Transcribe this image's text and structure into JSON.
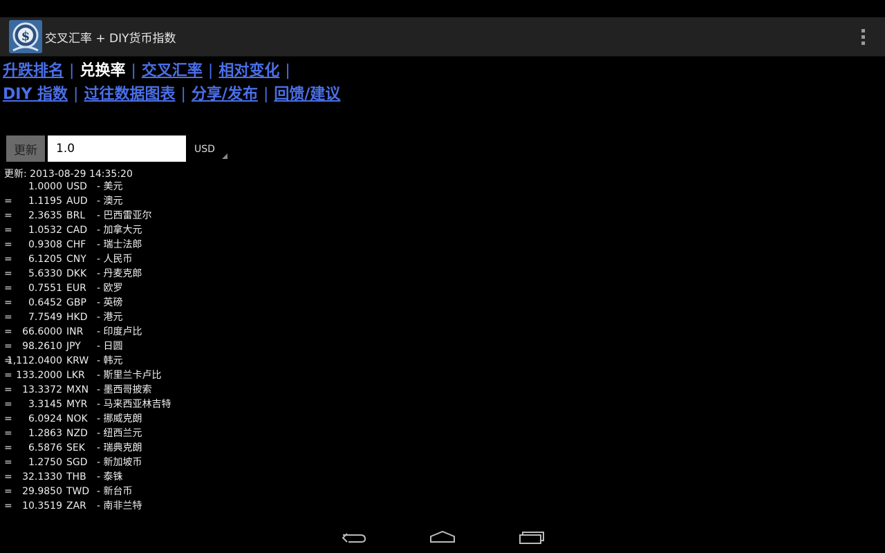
{
  "app": {
    "title": "交叉汇率 + DIY货币指数",
    "icon_name": "dollar-logo-icon",
    "menu_icon": "overflow-menu-icon"
  },
  "nav": {
    "row1": [
      {
        "label": "升跌排名",
        "current": false
      },
      {
        "label": "兑换率",
        "current": true
      },
      {
        "label": "交叉汇率",
        "current": false
      },
      {
        "label": "相对变化",
        "current": false
      }
    ],
    "row2": [
      {
        "label": "DIY 指数",
        "current": false
      },
      {
        "label": "过往数据图表",
        "current": false
      },
      {
        "label": "分享/发布",
        "current": false
      },
      {
        "label": "回馈/建议",
        "current": false
      }
    ],
    "separator": "|"
  },
  "converter": {
    "refresh_label": "更新",
    "amount_value": "1.0",
    "currency": "USD"
  },
  "updated": "更新: 2013-08-29 14:35:20",
  "rates": [
    {
      "eq": "",
      "amount": "1.0000",
      "code": "USD",
      "name": "- 美元"
    },
    {
      "eq": "=",
      "amount": "1.1195",
      "code": "AUD",
      "name": "- 澳元"
    },
    {
      "eq": "=",
      "amount": "2.3635",
      "code": "BRL",
      "name": "- 巴西雷亚尔"
    },
    {
      "eq": "=",
      "amount": "1.0532",
      "code": "CAD",
      "name": "- 加拿大元"
    },
    {
      "eq": "=",
      "amount": "0.9308",
      "code": "CHF",
      "name": "- 瑞士法郎"
    },
    {
      "eq": "=",
      "amount": "6.1205",
      "code": "CNY",
      "name": "- 人民币"
    },
    {
      "eq": "=",
      "amount": "5.6330",
      "code": "DKK",
      "name": "- 丹麦克郎"
    },
    {
      "eq": "=",
      "amount": "0.7551",
      "code": "EUR",
      "name": "- 欧罗"
    },
    {
      "eq": "=",
      "amount": "0.6452",
      "code": "GBP",
      "name": "- 英磅"
    },
    {
      "eq": "=",
      "amount": "7.7549",
      "code": "HKD",
      "name": "- 港元"
    },
    {
      "eq": "=",
      "amount": "66.6000",
      "code": "INR",
      "name": "- 印度卢比"
    },
    {
      "eq": "=",
      "amount": "98.2610",
      "code": "JPY",
      "name": "- 日圆"
    },
    {
      "eq": "=",
      "amount": "1,112.0400",
      "code": "KRW",
      "name": "- 韩元"
    },
    {
      "eq": "=",
      "amount": "133.2000",
      "code": "LKR",
      "name": "- 斯里兰卡卢比"
    },
    {
      "eq": "=",
      "amount": "13.3372",
      "code": "MXN",
      "name": "- 墨西哥披索"
    },
    {
      "eq": "=",
      "amount": "3.3145",
      "code": "MYR",
      "name": "- 马来西亚林吉特"
    },
    {
      "eq": "=",
      "amount": "6.0924",
      "code": "NOK",
      "name": "- 挪威克朗"
    },
    {
      "eq": "=",
      "amount": "1.2863",
      "code": "NZD",
      "name": "- 纽西兰元"
    },
    {
      "eq": "=",
      "amount": "6.5876",
      "code": "SEK",
      "name": "- 瑞典克朗"
    },
    {
      "eq": "=",
      "amount": "1.2750",
      "code": "SGD",
      "name": "- 新加坡币"
    },
    {
      "eq": "=",
      "amount": "32.1330",
      "code": "THB",
      "name": "- 泰铢"
    },
    {
      "eq": "=",
      "amount": "29.9850",
      "code": "TWD",
      "name": "- 新台币"
    },
    {
      "eq": "=",
      "amount": "10.3519",
      "code": "ZAR",
      "name": "- 南非兰特"
    }
  ],
  "system_nav": {
    "back_icon": "back-icon",
    "home_icon": "home-icon",
    "recents_icon": "recent-apps-icon"
  },
  "colors": {
    "link": "#4a6fe8",
    "action_bar": "#222222",
    "background": "#000000"
  }
}
